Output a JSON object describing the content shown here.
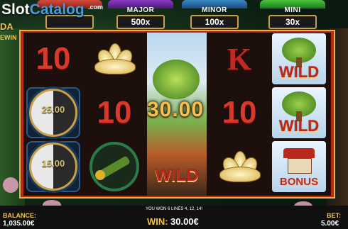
{
  "watermark": {
    "part1": "Slot",
    "part2": "Catalog",
    "suffix": ".com"
  },
  "game_logo": {
    "line1": "DA",
    "line2": "EWIN"
  },
  "jackpots": [
    {
      "label": "",
      "value": ""
    },
    {
      "label": "MAJOR",
      "value": "500x"
    },
    {
      "label": "MINOR",
      "value": "100x"
    },
    {
      "label": "MINI",
      "value": "30x"
    }
  ],
  "reels": {
    "col1": [
      "10",
      "25.00",
      "15.00"
    ],
    "col2": [
      "lotus",
      "10",
      "bamboo"
    ],
    "col3": "WILD",
    "col4": [
      "K",
      "10",
      "lotus"
    ],
    "col5": [
      "WILD",
      "WILD",
      "BONUS"
    ]
  },
  "win_display": "30.00",
  "bottom": {
    "balance_label": "BALANCE:",
    "balance_value": "1,035.00€",
    "win_lines_text": "YOU WON 6 LINES 4, 12, 14!",
    "win_label": "WIN:",
    "win_value": "30.00€",
    "bet_label": "BET:",
    "bet_value": "5.00€"
  },
  "colors": {
    "accent": "#f3c24a",
    "symbol_red": "#d8392a",
    "frame": "#b8281c"
  }
}
